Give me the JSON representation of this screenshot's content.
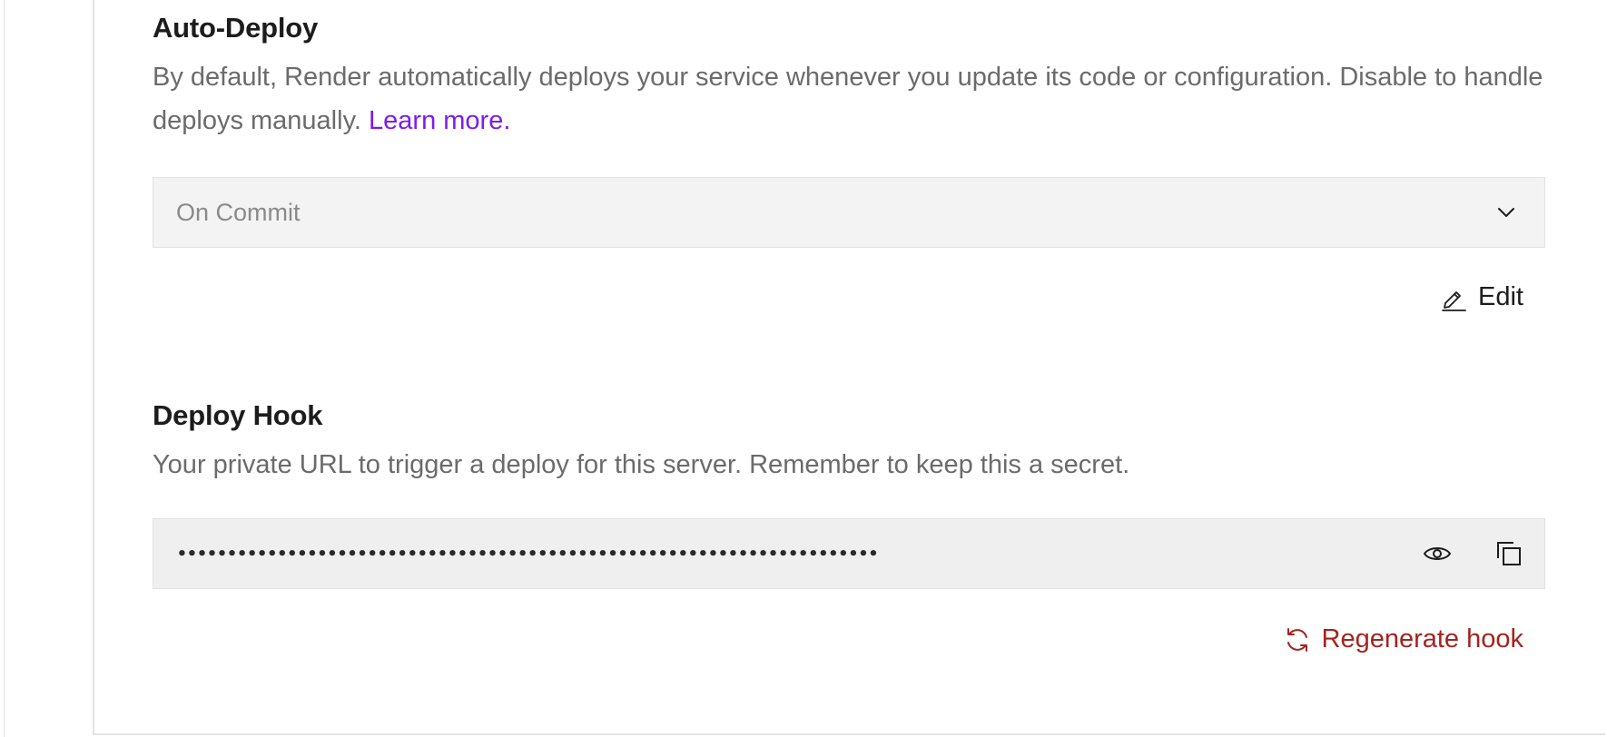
{
  "auto_deploy": {
    "title": "Auto-Deploy",
    "description": "By default, Render automatically deploys your service whenever you update its code or configuration. Disable to handle deploys manually.",
    "learn_more_label": "Learn more.",
    "select_value": "On Commit",
    "select_icon": "chevron-down-icon",
    "edit_label": "Edit",
    "edit_icon": "pencil-icon"
  },
  "deploy_hook": {
    "title": "Deploy Hook",
    "description": "Your private URL to trigger a deploy for this server. Remember to keep this a secret.",
    "masked_value": "••••••••••••••••••••••••••••••••••••••••••••••••••••••••••••••••••••••",
    "reveal_icon": "eye-icon",
    "copy_icon": "copy-icon",
    "regenerate_label": "Regenerate hook",
    "regenerate_icon": "refresh-icon"
  },
  "colors": {
    "link": "#7c1cf0",
    "danger": "#a4231f",
    "text_primary": "#1c1c1c",
    "text_secondary": "#6b6b6b"
  }
}
